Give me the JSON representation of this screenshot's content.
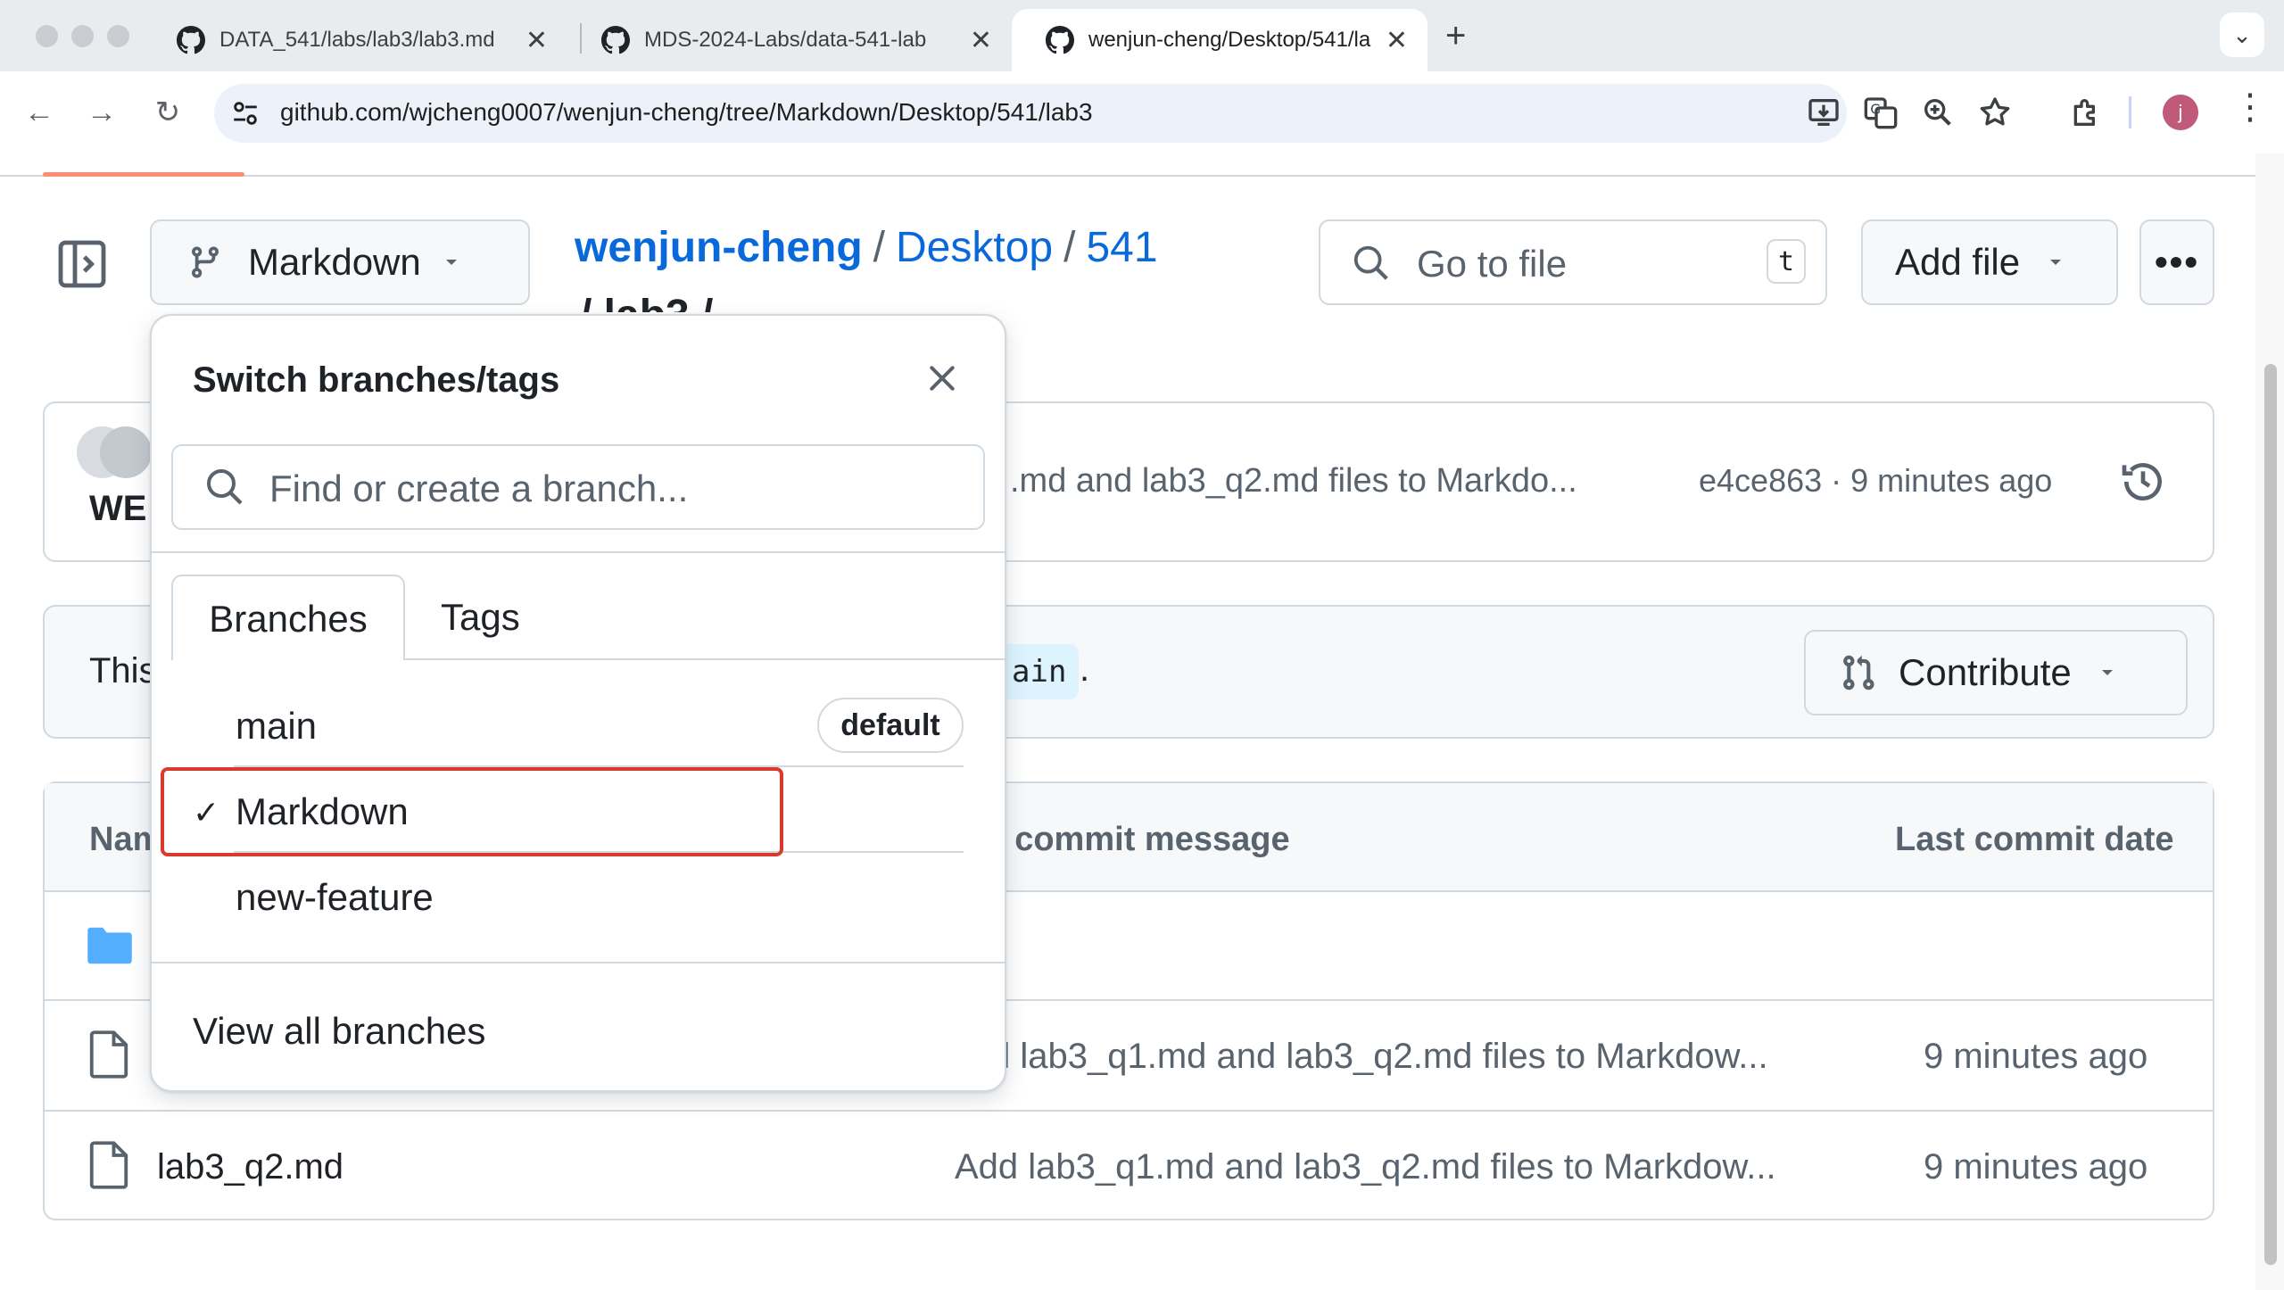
{
  "browser": {
    "tabs": [
      {
        "title": "DATA_541/labs/lab3/lab3.md",
        "active": false
      },
      {
        "title": "MDS-2024-Labs/data-541-lab",
        "active": false
      },
      {
        "title": "wenjun-cheng/Desktop/541/la",
        "active": true
      }
    ],
    "new_tab_icon": "plus-icon",
    "url": "github.com/wjcheng0007/wenjun-cheng/tree/Markdown/Desktop/541/lab3",
    "profile_initial": "j"
  },
  "repo": {
    "branch_button_label": "Markdown",
    "breadcrumb": {
      "owner": "wenjun-cheng",
      "part1": "Desktop",
      "part2": "541",
      "line2": "/ lab3 / "
    },
    "goto_placeholder": "Go to file",
    "goto_shortcut": "t",
    "add_file_label": "Add file",
    "more_label": "•••"
  },
  "commit": {
    "owner_fragment": "WE",
    "message": ".md and lab3_q2.md files to Markdo...",
    "hash_time": "e4ce863 · 9 minutes ago"
  },
  "branch_info": {
    "text_fragment": "This",
    "code_fragment": "ain",
    "trailing": ".",
    "contribute_label": "Contribute"
  },
  "files": {
    "headers": {
      "name": "Nam",
      "message": "t commit message",
      "date": "Last commit date"
    },
    "rows": [
      {
        "name": "",
        "message": "",
        "date": "",
        "icon": "folder-icon"
      },
      {
        "name": "",
        "message": "d lab3_q1.md and lab3_q2.md files to Markdow...",
        "date": "9 minutes ago",
        "icon": "file-icon"
      },
      {
        "name": "lab3_q2.md",
        "message": "Add lab3_q1.md and lab3_q2.md files to Markdow...",
        "date": "9 minutes ago",
        "icon": "file-icon"
      }
    ]
  },
  "dropdown": {
    "title": "Switch branches/tags",
    "search_placeholder": "Find or create a branch...",
    "tabs": {
      "branches": "Branches",
      "tags": "Tags"
    },
    "branches": [
      {
        "name": "main",
        "badge": "default",
        "selected": false
      },
      {
        "name": "Markdown",
        "badge": "",
        "selected": true
      },
      {
        "name": "new-feature",
        "badge": "",
        "selected": false
      }
    ],
    "checkmark": "✓",
    "view_all": "View all branches"
  },
  "colors": {
    "link": "#0969da",
    "highlight_border": "#d93a2b",
    "border": "#d1d9e0",
    "muted": "#59636e"
  }
}
